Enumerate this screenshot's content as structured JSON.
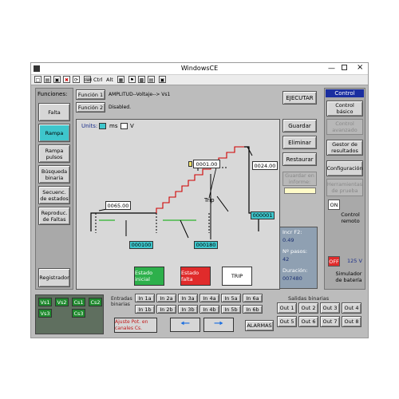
{
  "window": {
    "title": "WindowsCE"
  },
  "toolbar": {
    "ctrl_label": "Ctrl",
    "alt_label": "Alt"
  },
  "left_panel": {
    "title": "Funciones:",
    "items": [
      {
        "label": "Falta"
      },
      {
        "label": "Rampa"
      },
      {
        "label": "Rampa pulsos"
      },
      {
        "label": "Búsqueda binaria"
      },
      {
        "label": "Secuenc. de estados"
      },
      {
        "label": "Reproduc. de Faltas"
      }
    ],
    "registrador": "Registrador"
  },
  "header": {
    "funcion1": "Función 1",
    "funcion1_text": "AMPLITUD--Voltaje--> Vs1",
    "funcion2": "Función 2",
    "funcion2_text": "Disabled."
  },
  "units": {
    "label": "Units:",
    "ms": "ms",
    "v": "V"
  },
  "chart": {
    "val1": "0065.00",
    "val2": "0001.00",
    "val3": "0024.00",
    "trip_label": "Trip",
    "cyan1": "000100",
    "cyan2": "000180",
    "cyan3": "000001",
    "estado_inicial": "Estado inicial",
    "estado_falta": "Estado falta",
    "trip": "TRIP"
  },
  "middle_right": {
    "ejecutar": "EJECUTAR",
    "guardar": "Guardar",
    "eliminar": "Eliminar",
    "restaurar": "Restaurar",
    "guardar_informe": "Guardar en informe:"
  },
  "info": {
    "incr_label": "Incr F2:",
    "incr_val": "0.49",
    "pasos_label": "Nº pasos:",
    "pasos_val": "42",
    "duracion_label": "Duración:",
    "duracion_val": "007480"
  },
  "right_panel": {
    "title": "Control",
    "items": [
      {
        "label": "Control básico",
        "enabled": true
      },
      {
        "label": "Control avanzado",
        "enabled": false
      },
      {
        "label": "Gestor de resultados",
        "enabled": true
      },
      {
        "label": "Configuración",
        "enabled": true
      },
      {
        "label": "Herramientas de prueba",
        "enabled": false
      }
    ],
    "on": "ON",
    "control_remoto": "Control remoto",
    "off": "OFF",
    "voltage": "125 V",
    "simulador": "Simulador de batería"
  },
  "bottom": {
    "vs": [
      "Vs1",
      "Vs2",
      "Cs1",
      "Cs2",
      "Vs3",
      "Cs3"
    ],
    "entradas_label": "Entradas binarias",
    "entradas": [
      "In 1a",
      "In 2a",
      "In 3a",
      "In 4a",
      "In 5a",
      "In 6a",
      "In 1b",
      "In 2b",
      "In 3b",
      "In 4b",
      "In 5b",
      "In 6b"
    ],
    "ajuste": "Ajuste Pot. en canales Cs.",
    "alarmas": "ALARMAS",
    "salidas_label": "Salidas binarias",
    "salidas": [
      "Out 1",
      "Out 2",
      "Out 3",
      "Out 4",
      "Out 5",
      "Out 6",
      "Out 7",
      "Out 8"
    ]
  }
}
